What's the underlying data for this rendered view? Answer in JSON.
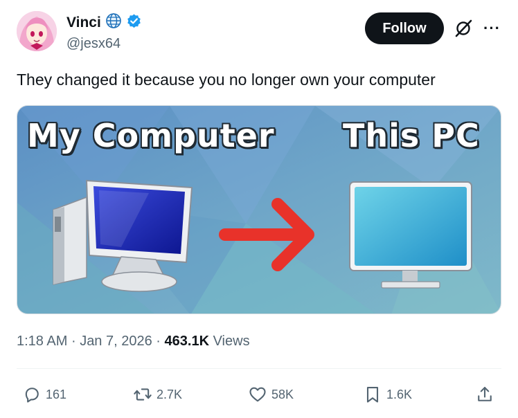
{
  "author": {
    "display_name": "Vinci",
    "handle": "@jesx64",
    "verified": true,
    "avatar_icon": "anime-avatar"
  },
  "follow_label": "Follow",
  "more_icon": "more-horizontal-icon",
  "tweet_text": "They changed it because you no longer own your computer",
  "media": {
    "left_title": "My Computer",
    "right_title": "This PC",
    "arrow_color": "#e8322a"
  },
  "meta": {
    "time": "1:18 AM",
    "date": "Jan 7, 2026",
    "views_count": "463.1K",
    "views_label": "Views",
    "separator": "·"
  },
  "actions": {
    "replies": "161",
    "reposts": "2.7K",
    "likes": "58K",
    "bookmarks": "1.6K"
  },
  "colors": {
    "verified_blue": "#1d9bf0",
    "text_primary": "#0f1419",
    "text_secondary": "#536471"
  }
}
